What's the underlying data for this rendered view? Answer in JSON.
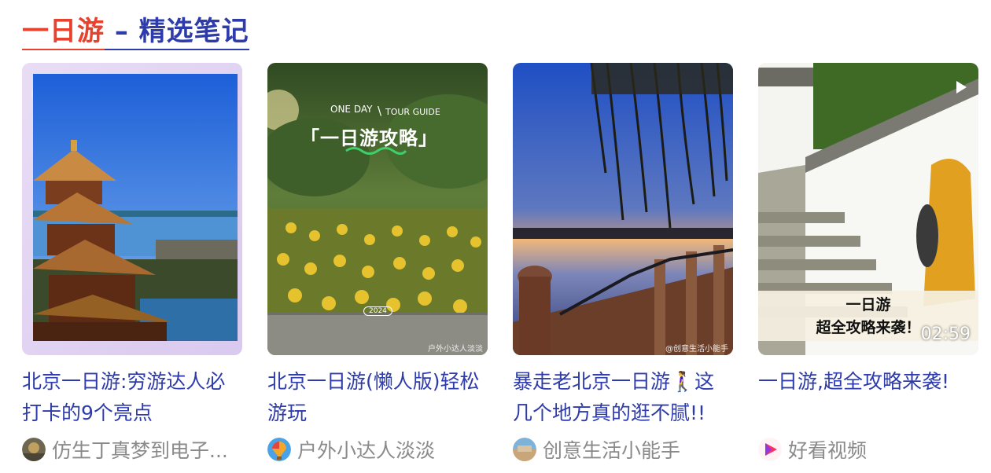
{
  "header": {
    "highlight": "一日游",
    "rest": " – 精选笔记",
    "colors": {
      "highlight": "#e8412d",
      "primary": "#2d3bab",
      "meta": "#8a8a8a"
    }
  },
  "cards": [
    {
      "title": "北京一日游:穷游达人必打卡的9个亮点",
      "author": "仿生丁真梦到电子...",
      "image": "pagoda-by-lake"
    },
    {
      "title": "北京一日游(懒人版)轻松游玩",
      "author": "户外小达人淡淡",
      "image": "sunflower-field",
      "overlay": {
        "line1a": "ONE DAY",
        "line1b": "TOUR GUIDE",
        "headline": "「一日游攻略」",
        "year": "2024",
        "watermark": "户外小达人淡淡"
      }
    },
    {
      "title": "暴走老北京一日游🚶‍♀️这几个地方真的逛不腻!!",
      "author": "创意生活小能手",
      "image": "lake-sunset-willow",
      "overlay": {
        "watermark": "@创意生活小能手"
      }
    },
    {
      "title": "一日游,超全攻略来袭!",
      "author": "好看视频",
      "image": "white-wall-stairs-video",
      "overlay": {
        "banner_line1": "一日游",
        "banner_line2": "超全攻略来袭！",
        "duration": "02:59"
      }
    }
  ]
}
